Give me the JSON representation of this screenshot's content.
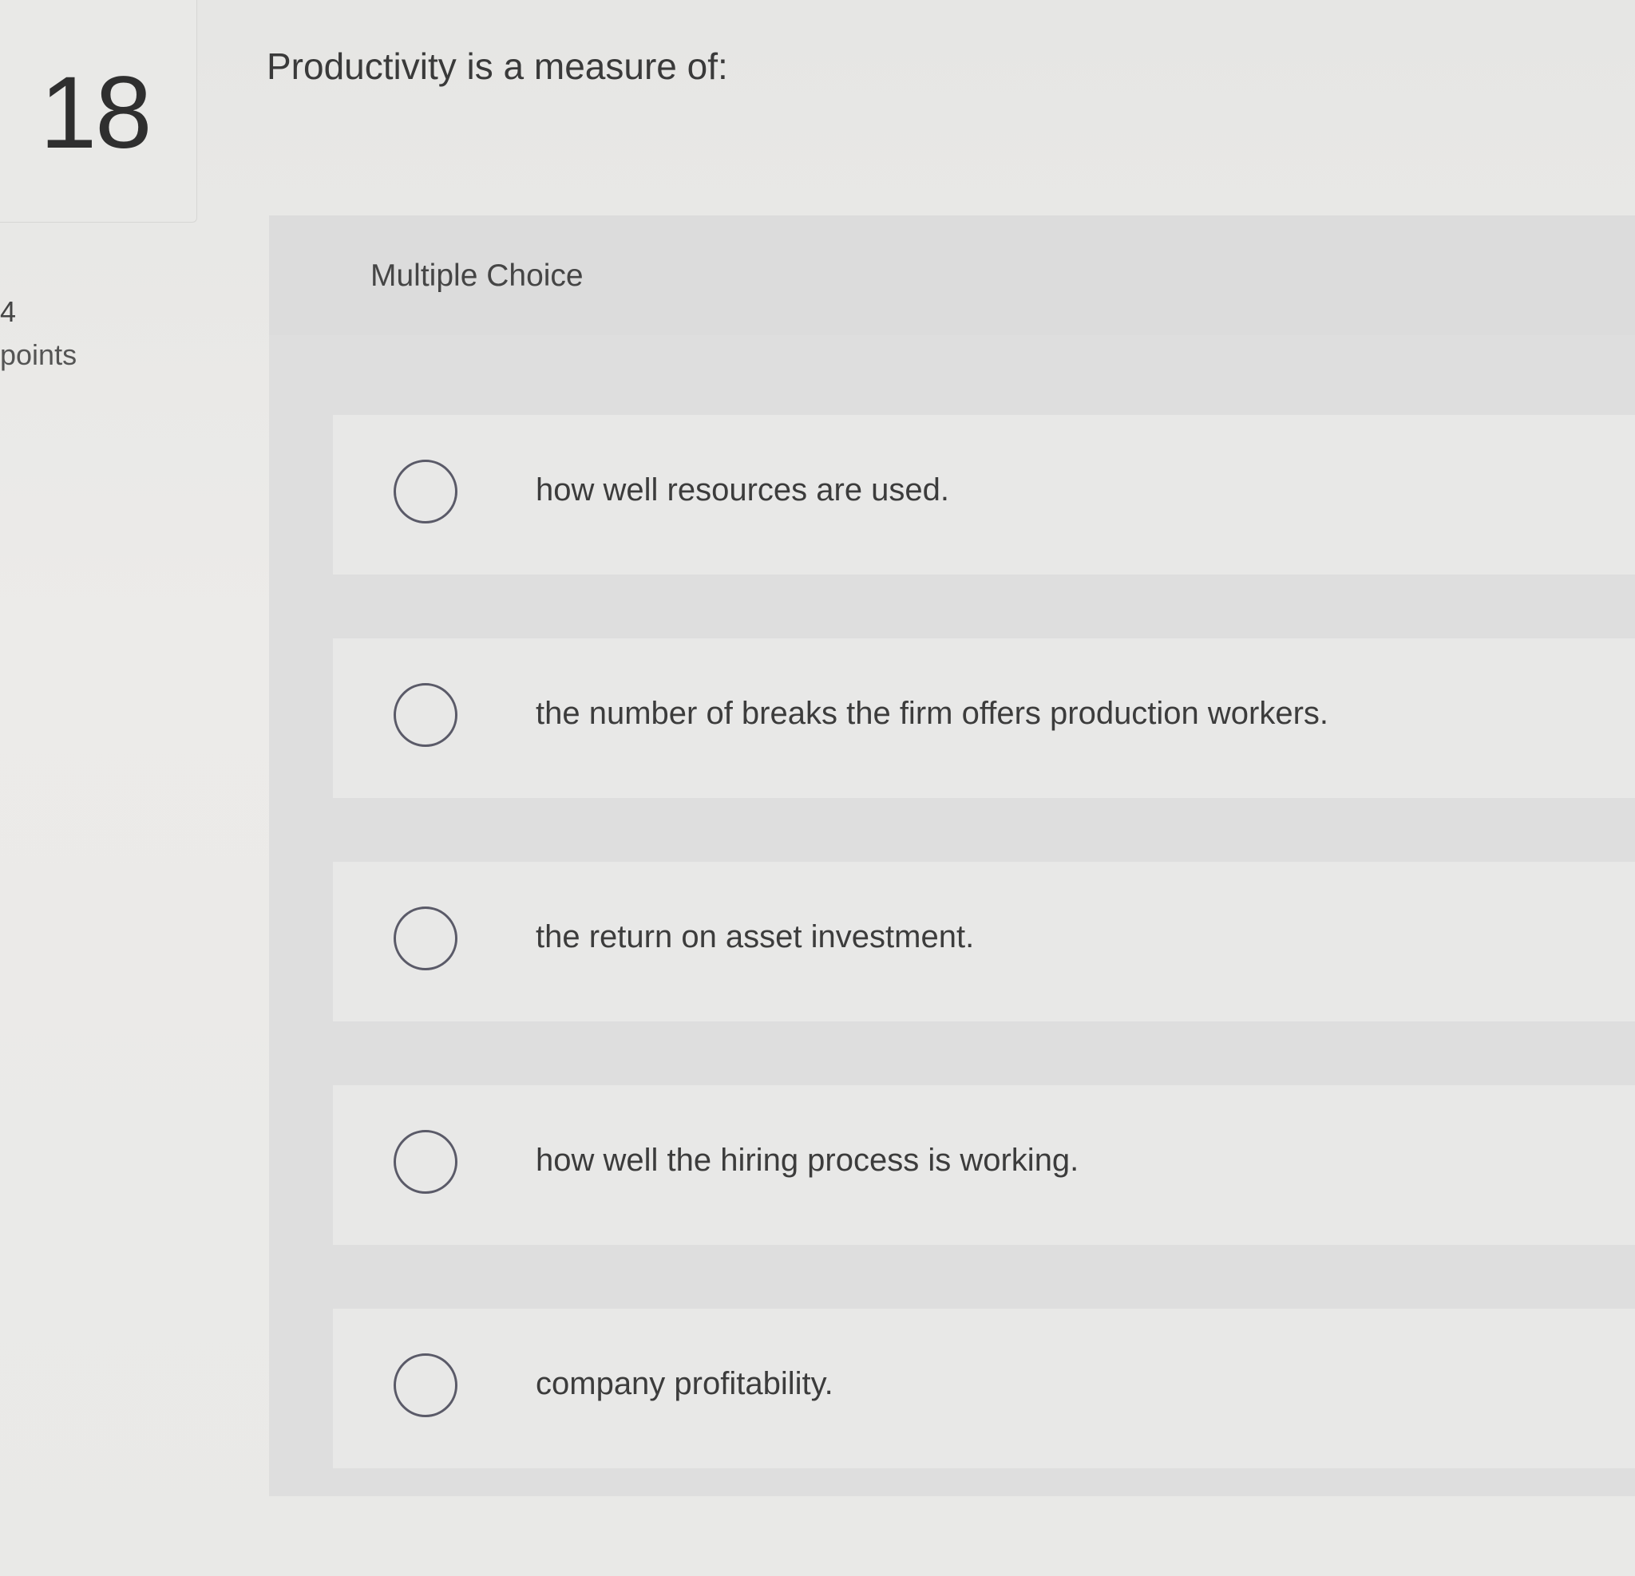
{
  "question": {
    "number": "18",
    "text": "Productivity is a measure of:",
    "points_value": "4",
    "points_label": "points"
  },
  "answer_panel": {
    "header": "Multiple Choice",
    "options": [
      {
        "label": "how well resources are used."
      },
      {
        "label": "the number of breaks the firm offers production workers."
      },
      {
        "label": "the return on asset investment."
      },
      {
        "label": "how well the hiring process is working."
      },
      {
        "label": "company profitability."
      }
    ]
  }
}
